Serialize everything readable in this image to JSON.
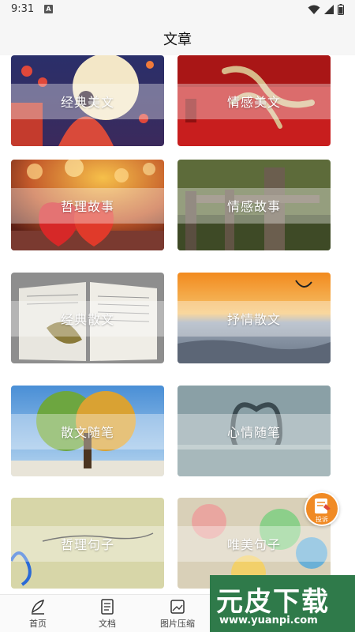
{
  "status": {
    "time": "9:31",
    "notification_letter": "A",
    "icons": [
      "wifi-icon",
      "signal-icon",
      "battery-icon"
    ]
  },
  "header": {
    "title": "文章"
  },
  "cards": [
    {
      "label": "经典美文",
      "art": "night-moon-girl"
    },
    {
      "label": "情感美文",
      "art": "red-calligraphy"
    },
    {
      "label": "哲理故事",
      "art": "red-hearts-bokeh"
    },
    {
      "label": "情感故事",
      "art": "wooden-fence"
    },
    {
      "label": "经典散文",
      "art": "open-book-leaf"
    },
    {
      "label": "抒情散文",
      "art": "orange-sea-sunset"
    },
    {
      "label": "散文随笔",
      "art": "tree-seasons"
    },
    {
      "label": "心情随笔",
      "art": "heart-swan"
    },
    {
      "label": "哲理句子",
      "art": "handwriting-paper"
    },
    {
      "label": "唯美句子",
      "art": "colorful-pompoms"
    }
  ],
  "floating_button": {
    "label": "投诉"
  },
  "bottom_nav": [
    {
      "label": "首页",
      "icon": "feather-icon"
    },
    {
      "label": "文档",
      "icon": "document-icon"
    },
    {
      "label": "图片压缩",
      "icon": "image-icon"
    }
  ],
  "watermark": {
    "title": "元皮下载",
    "url": "www.yuanpi.com"
  },
  "colors": {
    "accent": "#f08a24",
    "watermark_bg": "#2f7a4a"
  }
}
